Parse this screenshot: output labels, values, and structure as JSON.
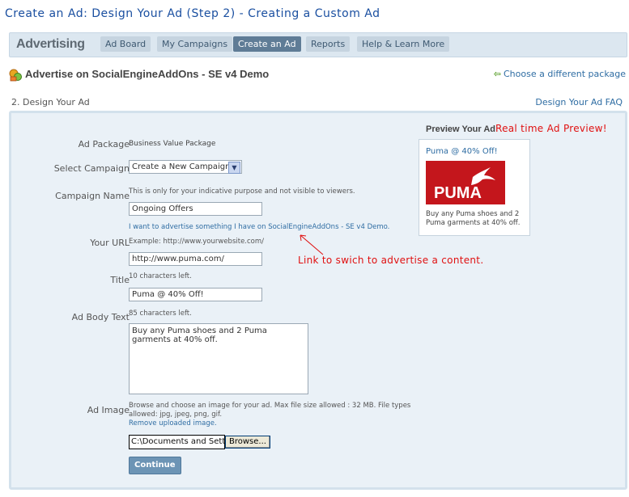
{
  "page": {
    "title": "Create an Ad: Design Your Ad (Step 2) - Creating a Custom Ad"
  },
  "nav": {
    "brand": "Advertising",
    "tabs": [
      {
        "label": "Ad Board",
        "active": false
      },
      {
        "label": "My Campaigns",
        "active": false
      },
      {
        "label": "Create an Ad",
        "active": true
      },
      {
        "label": "Reports",
        "active": false
      },
      {
        "label": "Help & Learn More",
        "active": false
      }
    ]
  },
  "header": {
    "title": "Advertise on SocialEngineAddOns - SE v4 Demo",
    "choose_package": "Choose a different package",
    "step": "2. Design Your Ad",
    "faq": "Design Your Ad FAQ"
  },
  "form": {
    "ad_package": {
      "label": "Ad Package",
      "value": "Business Value Package"
    },
    "select_campaign": {
      "label": "Select Campaign",
      "value": "Create a New Campaign"
    },
    "campaign_name": {
      "label": "Campaign Name",
      "hint": "This is only for your indicative purpose and not visible to viewers.",
      "value": "Ongoing Offers"
    },
    "switch_link": "I want to advertise something I have on SocialEngineAddOns - SE v4 Demo.",
    "url": {
      "label": "Your URL",
      "hint": "Example: http://www.yourwebsite.com/",
      "value": "http://www.puma.com/"
    },
    "title": {
      "label": "Title",
      "hint": "10 characters left.",
      "value": "Puma @ 40% Off!"
    },
    "body": {
      "label": "Ad Body Text",
      "hint": "85 characters left.",
      "value": "Buy any Puma shoes and 2 Puma garments at 40% off."
    },
    "image": {
      "label": "Ad Image",
      "hint_line1": "Browse and choose an image for your ad. Max file size allowed : 32 MB. File types",
      "hint_line2": "allowed: jpg, jpeg, png, gif.",
      "remove_link": "Remove uploaded image.",
      "file_value": "C:\\Documents and Setti",
      "browse_label": "Browse..."
    },
    "continue_label": "Continue"
  },
  "preview": {
    "heading": "Preview Your Ad",
    "ad_title": "Puma @ 40% Off!",
    "logo_text": "PUMA",
    "ad_body": "Buy any Puma shoes and 2 Puma garments at 40% off."
  },
  "annotations": {
    "preview_note": "Real time Ad Preview!",
    "link_note": "Link to swich to advertise a content."
  },
  "colors": {
    "title_blue": "#1a4fa0",
    "link_blue": "#2f6da3",
    "annotation_red": "#e01010",
    "active_tab": "#5f7c96",
    "puma_red": "#c4161c"
  }
}
